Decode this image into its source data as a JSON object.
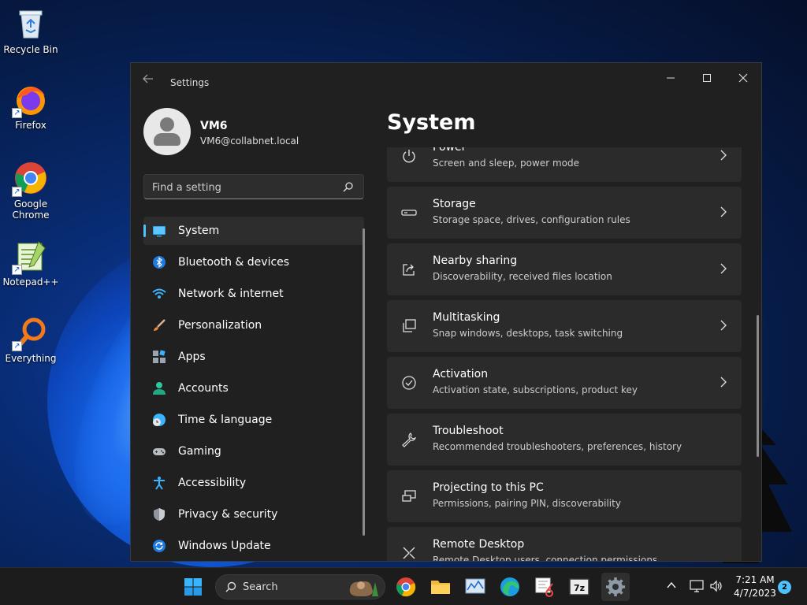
{
  "desktop": {
    "icons": [
      {
        "label": "Recycle Bin"
      },
      {
        "label": "Firefox"
      },
      {
        "label": "Google Chrome"
      },
      {
        "label": "Notepad++"
      },
      {
        "label": "Everything"
      }
    ]
  },
  "window": {
    "title": "Settings",
    "profile": {
      "name": "VM6",
      "email": "VM6@collabnet.local"
    },
    "search": {
      "placeholder": "Find a setting"
    },
    "nav": [
      {
        "label": "System",
        "icon": "display-icon",
        "active": true
      },
      {
        "label": "Bluetooth & devices",
        "icon": "bluetooth-icon"
      },
      {
        "label": "Network & internet",
        "icon": "wifi-icon"
      },
      {
        "label": "Personalization",
        "icon": "brush-icon"
      },
      {
        "label": "Apps",
        "icon": "apps-icon"
      },
      {
        "label": "Accounts",
        "icon": "person-icon"
      },
      {
        "label": "Time & language",
        "icon": "globe-clock-icon"
      },
      {
        "label": "Gaming",
        "icon": "gamepad-icon"
      },
      {
        "label": "Accessibility",
        "icon": "accessibility-icon"
      },
      {
        "label": "Privacy & security",
        "icon": "shield-icon"
      },
      {
        "label": "Windows Update",
        "icon": "update-icon"
      }
    ],
    "page_title": "System",
    "cards": [
      {
        "title": "Power",
        "subtitle": "Screen and sleep, power mode",
        "icon": "power-icon"
      },
      {
        "title": "Storage",
        "subtitle": "Storage space, drives, configuration rules",
        "icon": "storage-icon"
      },
      {
        "title": "Nearby sharing",
        "subtitle": "Discoverability, received files location",
        "icon": "share-icon"
      },
      {
        "title": "Multitasking",
        "subtitle": "Snap windows, desktops, task switching",
        "icon": "multitask-icon"
      },
      {
        "title": "Activation",
        "subtitle": "Activation state, subscriptions, product key",
        "icon": "check-circle-icon"
      },
      {
        "title": "Troubleshoot",
        "subtitle": "Recommended troubleshooters, preferences, history",
        "icon": "wrench-icon"
      },
      {
        "title": "Projecting to this PC",
        "subtitle": "Permissions, pairing PIN, discoverability",
        "icon": "projector-icon"
      },
      {
        "title": "Remote Desktop",
        "subtitle": "Remote Desktop users, connection permissions",
        "icon": "remote-desktop-icon"
      }
    ]
  },
  "taskbar": {
    "search_label": "Search",
    "time": "7:21 AM",
    "date": "4/7/2023",
    "notification_count": "2"
  },
  "colors": {
    "accent": "#4cc2ff",
    "window_bg": "#202020",
    "card_bg": "#2b2b2b"
  }
}
